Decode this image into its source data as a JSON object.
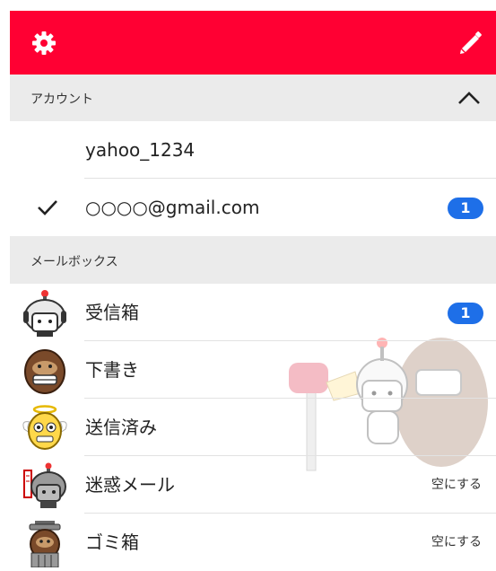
{
  "colors": {
    "brand": "#ff0033",
    "badge": "#1e6fe8",
    "section_bg": "#ebebeb"
  },
  "header": {
    "left_icon": "gear-icon",
    "right_icon": "pencil-icon"
  },
  "accounts": {
    "title": "アカウント",
    "items": [
      {
        "name": "yahoo_1234",
        "selected": false
      },
      {
        "name": "○○○○@gmail.com",
        "selected": true,
        "badge": "1"
      }
    ]
  },
  "mailbox": {
    "title": "メールボックス",
    "items": [
      {
        "label": "受信箱",
        "icon": "inbox-robot-icon",
        "badge": "1"
      },
      {
        "label": "下書き",
        "icon": "drafts-gorilla-icon"
      },
      {
        "label": "送信済み",
        "icon": "sent-angel-icon"
      },
      {
        "label": "迷惑メール",
        "icon": "spam-robot-icon",
        "action": "空にする"
      },
      {
        "label": "ゴミ箱",
        "icon": "trash-gorilla-icon",
        "action": "空にする"
      }
    ]
  }
}
